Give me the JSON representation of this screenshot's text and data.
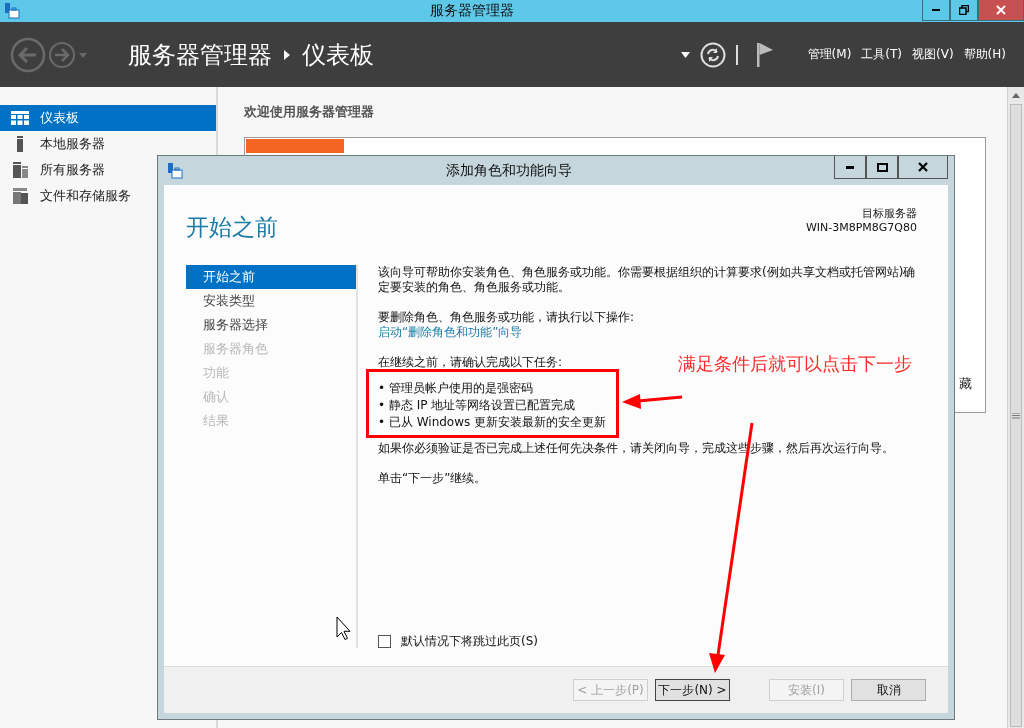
{
  "window": {
    "title": "服务器管理器"
  },
  "toolbar": {
    "breadcrumb": [
      "服务器管理器",
      "仪表板"
    ],
    "menus": [
      "管理(M)",
      "工具(T)",
      "视图(V)",
      "帮助(H)"
    ]
  },
  "sidebar": {
    "items": [
      {
        "label": "仪表板",
        "selected": true,
        "kind": "dashboard"
      },
      {
        "label": "本地服务器",
        "selected": false,
        "kind": "server"
      },
      {
        "label": "所有服务器",
        "selected": false,
        "kind": "servers"
      },
      {
        "label": "文件和存储服务",
        "selected": false,
        "kind": "files"
      }
    ]
  },
  "main": {
    "heading": "欢迎使用服务器管理器",
    "partial_text": "藏"
  },
  "dialog": {
    "title": "添加角色和功能向导",
    "heading": "开始之前",
    "target_label": "目标服务器",
    "target_server": "WIN-3M8PM8G7Q80",
    "steps": [
      {
        "label": "开始之前",
        "selected": true,
        "disabled": false
      },
      {
        "label": "安装类型",
        "selected": false,
        "disabled": false
      },
      {
        "label": "服务器选择",
        "selected": false,
        "disabled": false
      },
      {
        "label": "服务器角色",
        "selected": false,
        "disabled": true
      },
      {
        "label": "功能",
        "selected": false,
        "disabled": true
      },
      {
        "label": "确认",
        "selected": false,
        "disabled": true
      },
      {
        "label": "结果",
        "selected": false,
        "disabled": true
      }
    ],
    "intro": "该向导可帮助你安装角色、角色服务或功能。你需要根据组织的计算要求(例如共享文档或托管网站)确定要安装的角色、角色服务或功能。",
    "remove_text": "要删除角色、角色服务或功能，请执行以下操作:",
    "remove_link": "启动“删除角色和功能”向导",
    "confirm_text": "在继续之前，请确认完成以下任务:",
    "tasks": [
      "• 管理员帐户使用的是强密码",
      "• 静态 IP 地址等网络设置已配置完成",
      "• 已从 Windows 更新安装最新的安全更新"
    ],
    "note": "如果你必须验证是否已完成上述任何先决条件，请关闭向导，完成这些步骤，然后再次运行向导。",
    "continue_text": "单击“下一步”继续。",
    "skip_checkbox": {
      "label": "默认情况下将跳过此页(S)",
      "checked": false
    },
    "buttons": [
      {
        "label": "< 上一步(P)",
        "disabled": true,
        "default": false
      },
      {
        "label": "下一步(N) >",
        "disabled": false,
        "default": true
      },
      {
        "label": "安装(I)",
        "disabled": true,
        "default": false
      },
      {
        "label": "取消",
        "disabled": false,
        "default": false
      }
    ]
  },
  "annotation": {
    "text": "满足条件后就可以点击下一步"
  }
}
